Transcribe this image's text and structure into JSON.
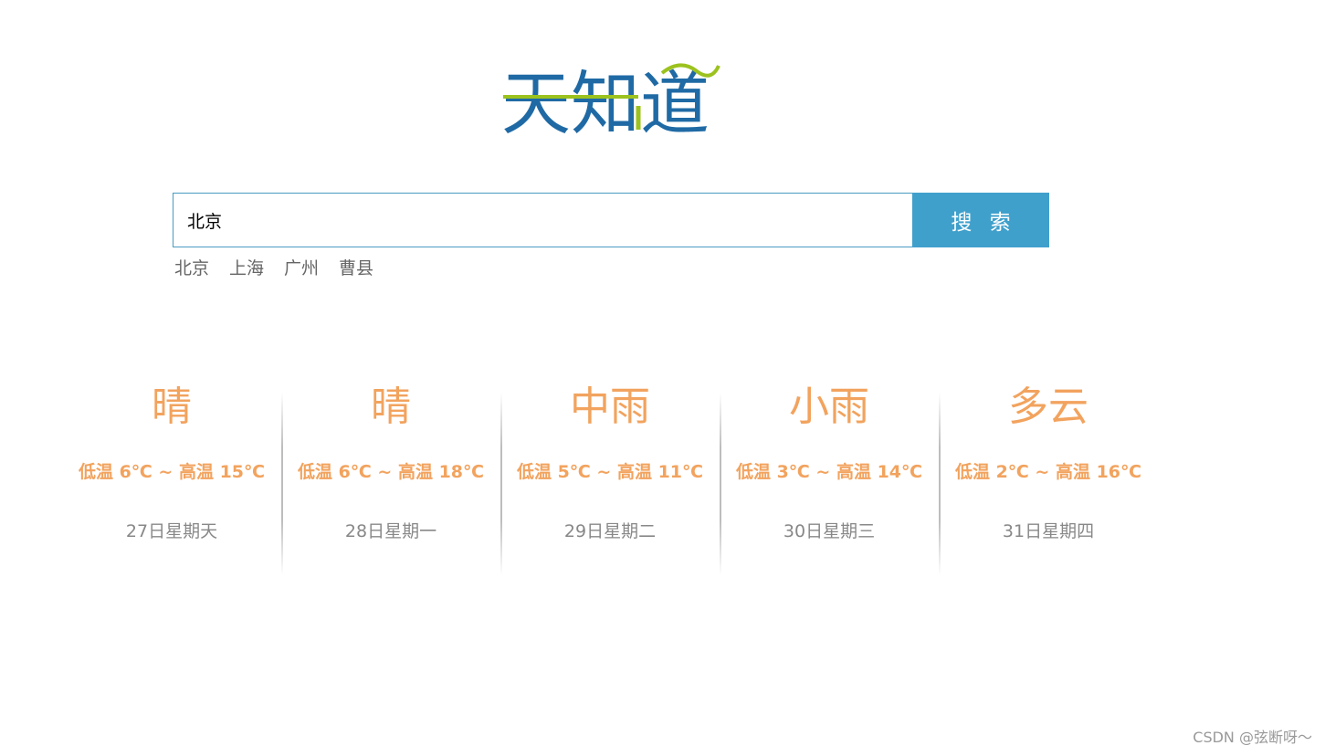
{
  "logo": {
    "text": "天知道",
    "colors": {
      "blue": "#1f6aa5",
      "green": "#9cc21e"
    }
  },
  "search": {
    "value": "北京",
    "button_label": "搜 索"
  },
  "hot_cities": [
    "北京",
    "上海",
    "广州",
    "曹县"
  ],
  "forecast": [
    {
      "weather": "晴",
      "temp": "低温 6℃ ~ 高温 15℃",
      "date": "27日星期天"
    },
    {
      "weather": "晴",
      "temp": "低温 6℃ ~ 高温 18℃",
      "date": "28日星期一"
    },
    {
      "weather": "中雨",
      "temp": "低温 5℃ ~ 高温 11℃",
      "date": "29日星期二"
    },
    {
      "weather": "小雨",
      "temp": "低温 3℃ ~ 高温 14℃",
      "date": "30日星期三"
    },
    {
      "weather": "多云",
      "temp": "低温 2℃ ~ 高温 16℃",
      "date": "31日星期四"
    }
  ],
  "watermark": "CSDN @弦断呀～",
  "colors": {
    "accent_orange": "#f2a35e",
    "button_blue": "#40a0cc",
    "date_gray": "#888888"
  }
}
